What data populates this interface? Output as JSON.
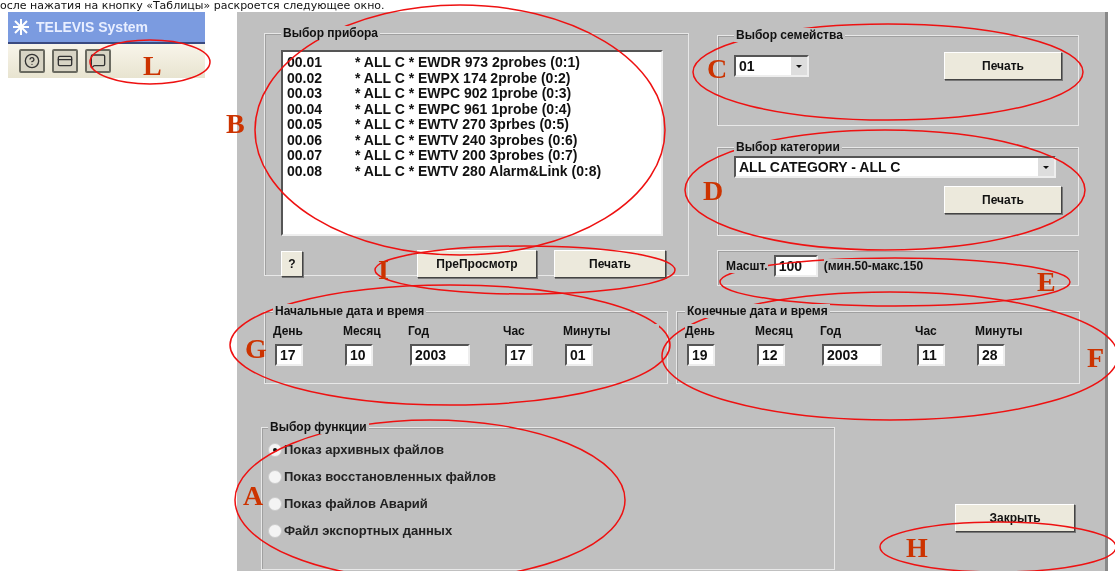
{
  "intro_text": "осле нажатия на кнопку «Таблицы» раскроется следующее окно.",
  "app_panel": {
    "title": "TELEVIS System",
    "toolbar_buttons": [
      {
        "kind": "help"
      },
      {
        "kind": "card"
      },
      {
        "kind": "chat"
      }
    ]
  },
  "dialog": {
    "device_group": {
      "title": "Выбор прибора",
      "items": [
        {
          "number": "00.01",
          "text": "* ALL C * EWDR 973 2probes (0:1)"
        },
        {
          "number": "00.02",
          "text": "* ALL C * EWPX 174 2probe (0:2)"
        },
        {
          "number": "00.03",
          "text": "* ALL C * EWPC 902 1probe (0:3)"
        },
        {
          "number": "00.04",
          "text": "* ALL C * EWPC 961 1probe (0:4)"
        },
        {
          "number": "00.05",
          "text": "* ALL C * EWTV 270 3prbes (0:5)"
        },
        {
          "number": "00.06",
          "text": "* ALL C * EWTV 240 3probes (0:6)"
        },
        {
          "number": "00.07",
          "text": "* ALL C * EWTV 200 3probes (0:7)"
        },
        {
          "number": "00.08",
          "text": "* ALL C * EWTV 280 Alarm&Link (0:8)"
        }
      ],
      "buttons": [
        "?",
        "ПреПросмотр",
        "Печать"
      ]
    },
    "family_group": {
      "title": "Выбор семейства",
      "value": "01",
      "button": "Печать"
    },
    "category_group": {
      "title": "Выбор категории",
      "value": "ALL CATEGORY - ALL C",
      "button": "Печать"
    },
    "scale": {
      "label": "Масшт.",
      "value": "100",
      "hint": "(мин.50-макс.150"
    },
    "start_group": {
      "title": "Начальные дата и время",
      "fields": [
        {
          "label": "День",
          "value": "17"
        },
        {
          "label": "Месяц",
          "value": "10"
        },
        {
          "label": "Год",
          "value": "2003"
        },
        {
          "label": "Час",
          "value": "17"
        },
        {
          "label": "Минуты",
          "value": "01"
        }
      ]
    },
    "end_group": {
      "title": "Конечные дата и время",
      "fields": [
        {
          "label": "День",
          "value": "19"
        },
        {
          "label": "Месяц",
          "value": "12"
        },
        {
          "label": "Год",
          "value": "2003"
        },
        {
          "label": "Час",
          "value": "11"
        },
        {
          "label": "Минуты",
          "value": "28"
        }
      ]
    },
    "function_group": {
      "title": "Выбор функции",
      "options": [
        {
          "label": "Показ архивных файлов",
          "selected": true
        },
        {
          "label": "Показ восстановленных файлов",
          "selected": false
        },
        {
          "label": "Показ файлов Аварий",
          "selected": false
        },
        {
          "label": "Файл экспортных данных",
          "selected": false
        }
      ]
    },
    "close_button": "Закрыть"
  },
  "annotations": [
    {
      "letter": "L"
    },
    {
      "letter": "B"
    },
    {
      "letter": "C"
    },
    {
      "letter": "D"
    },
    {
      "letter": "E"
    },
    {
      "letter": "I"
    },
    {
      "letter": "G"
    },
    {
      "letter": "F"
    },
    {
      "letter": "A"
    },
    {
      "letter": "H"
    }
  ]
}
